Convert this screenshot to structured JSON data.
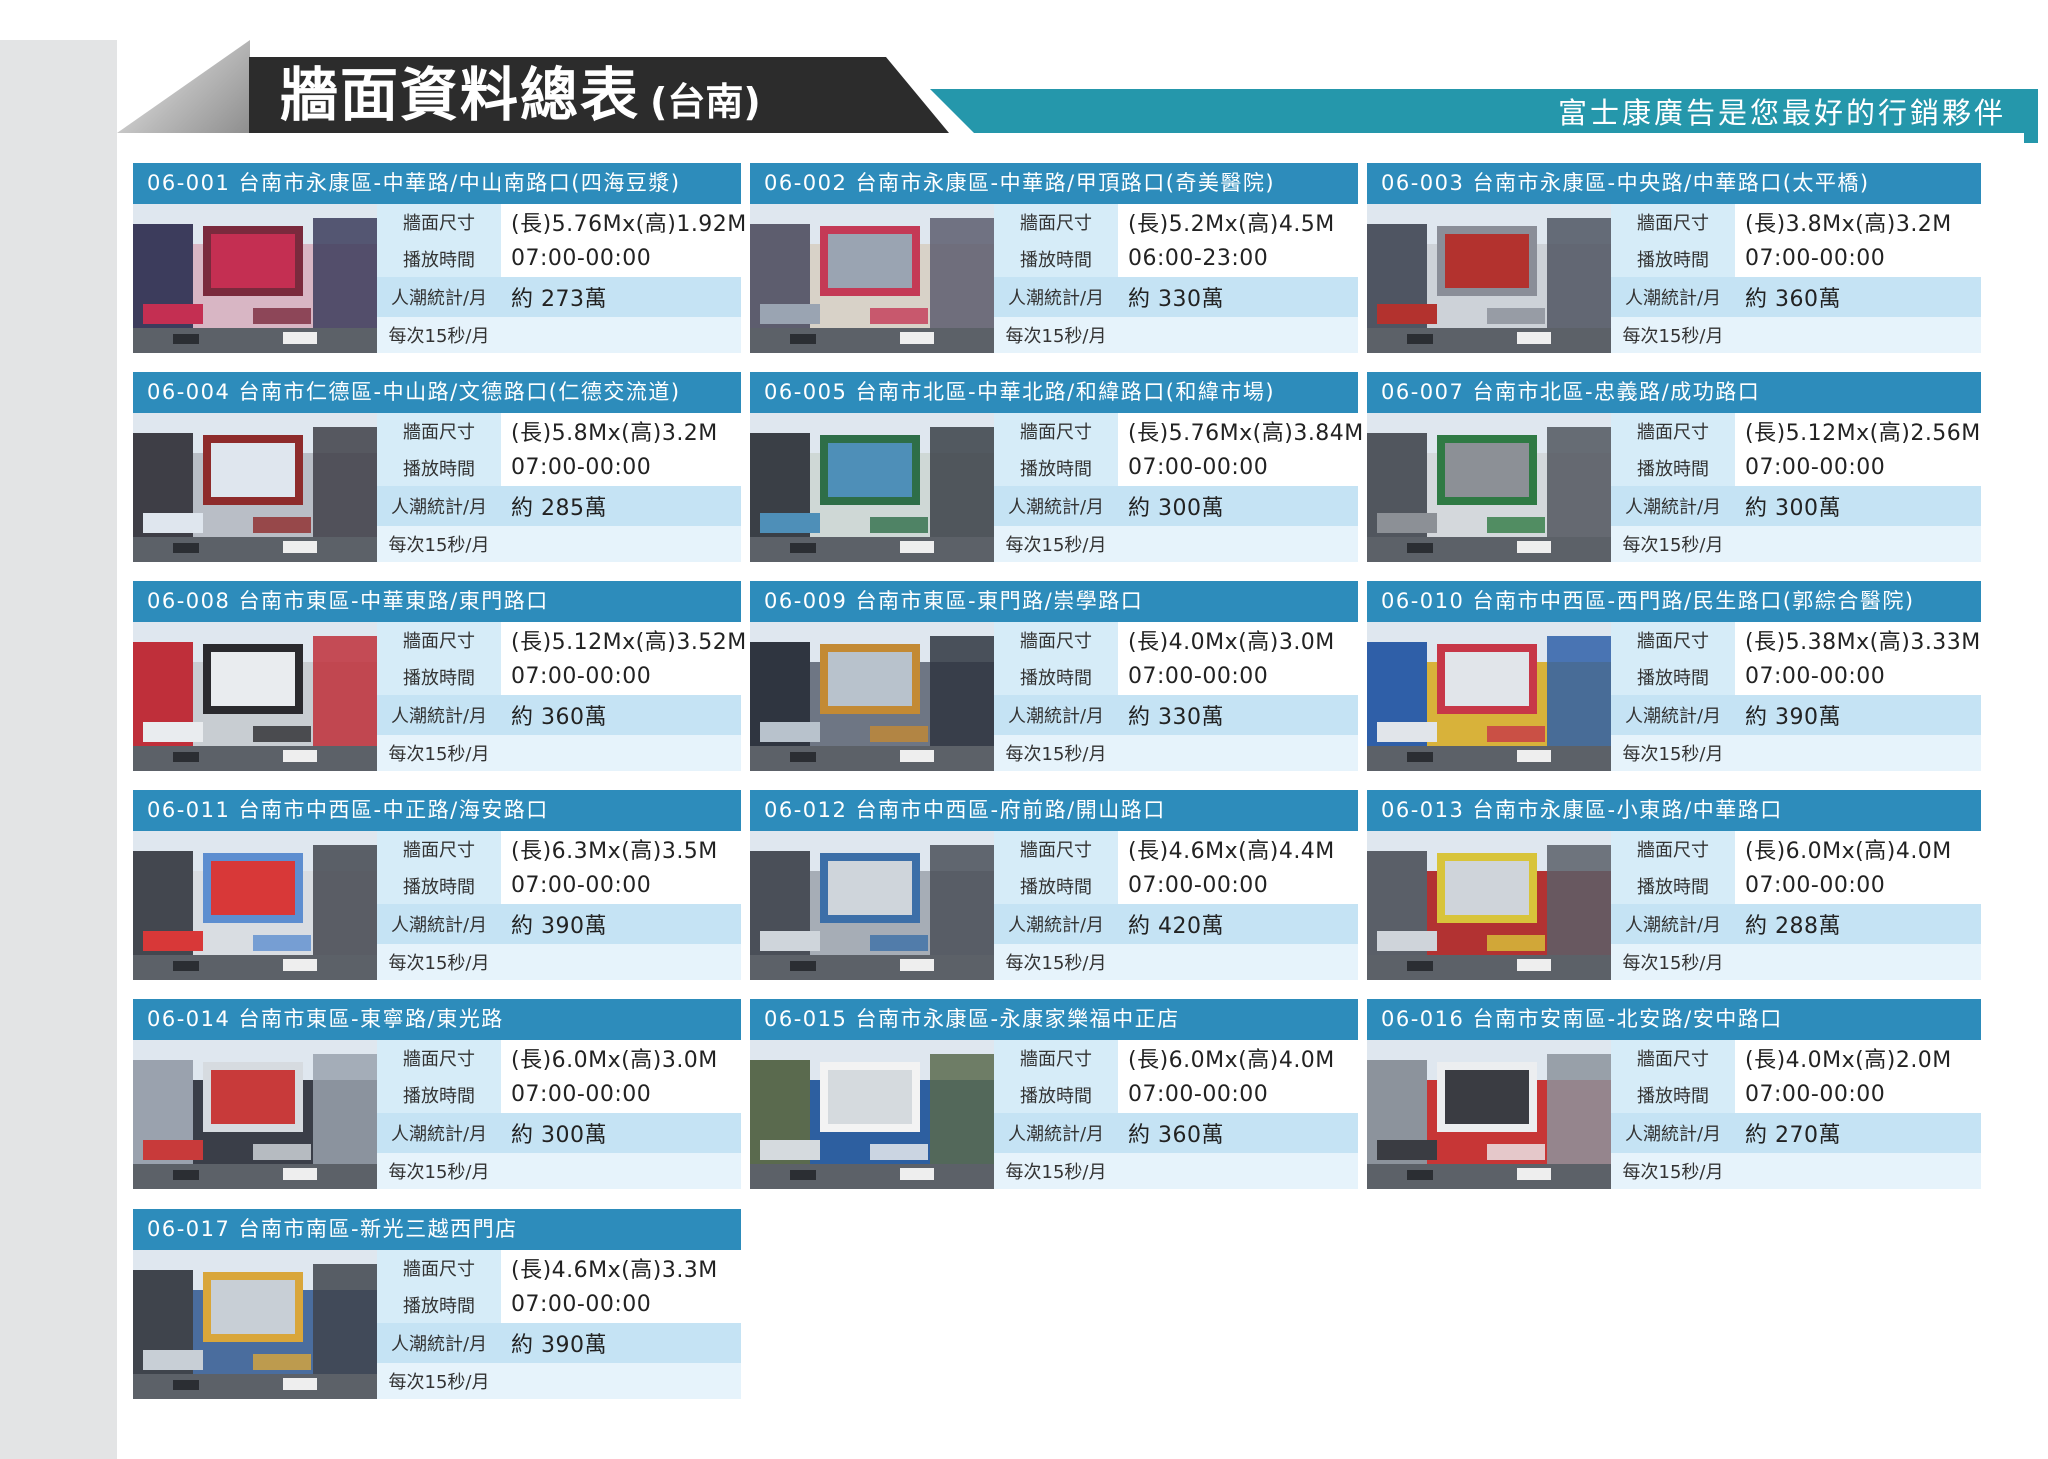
{
  "header": {
    "title": "牆面資料總表",
    "subtitle": "(台南)",
    "slogan": "富士康廣告是您最好的行銷夥伴"
  },
  "labels": {
    "size": "牆面尺寸",
    "time": "播放時間",
    "traffic": "人潮統計/月",
    "per": "每次15秒/月"
  },
  "cards": [
    {
      "title": "06-001 台南市永康區-中華路/中山南路口(四海豆漿)",
      "size": "(長)5.76Mx(高)1.92M",
      "time": "07:00-00:00",
      "traffic": "約 273萬",
      "photo": [
        "#c42f52",
        "#7a2a3d",
        "#d8b6c4",
        "#3c3c5c"
      ]
    },
    {
      "title": "06-002 台南市永康區-中華路/甲頂路口(奇美醫院)",
      "size": "(長)5.2Mx(高)4.5M",
      "time": "06:00-23:00",
      "traffic": "約 330萬",
      "photo": [
        "#9aa4b2",
        "#c43a56",
        "#d8d2c8",
        "#5d5d6e"
      ]
    },
    {
      "title": "06-003 台南市永康區-中央路/中華路口(太平橋)",
      "size": "(長)3.8Mx(高)3.2M",
      "time": "07:00-00:00",
      "traffic": "約 360萬",
      "photo": [
        "#b3322e",
        "#8a8e98",
        "#cdd2d8",
        "#4f5562"
      ]
    },
    {
      "title": "06-004 台南市仁德區-中山路/文德路口(仁德交流道)",
      "size": "(長)5.8Mx(高)3.2M",
      "time": "07:00-00:00",
      "traffic": "約 285萬",
      "photo": [
        "#dfe6ee",
        "#8e2b2b",
        "#b9bec6",
        "#3e3e46"
      ]
    },
    {
      "title": "06-005 台南市北區-中華北路/和緯路口(和緯市場)",
      "size": "(長)5.76Mx(高)3.84M",
      "time": "07:00-00:00",
      "traffic": "約 300萬",
      "photo": [
        "#4e8fb8",
        "#2e6e48",
        "#cfd8d6",
        "#3a3f46"
      ]
    },
    {
      "title": "06-007 台南市北區-忠義路/成功路口",
      "size": "(長)5.12Mx(高)2.56M",
      "time": "07:00-00:00",
      "traffic": "約 300萬",
      "photo": [
        "#8c9096",
        "#2f7a44",
        "#d4d8dc",
        "#51565e"
      ]
    },
    {
      "title": "06-008 台南市東區-中華東路/東門路口",
      "size": "(長)5.12Mx(高)3.52M",
      "time": "07:00-00:00",
      "traffic": "約 360萬",
      "photo": [
        "#e9ecef",
        "#2a2a2e",
        "#c8cdd2",
        "#bf2f3a"
      ]
    },
    {
      "title": "06-009 台南市東區-東門路/崇學路口",
      "size": "(長)4.0Mx(高)3.0M",
      "time": "07:00-00:00",
      "traffic": "約 330萬",
      "photo": [
        "#b8c2cc",
        "#c38a34",
        "#6e7684",
        "#2f3540"
      ]
    },
    {
      "title": "06-010 台南市中西區-西門路/民生路口(郭綜合醫院)",
      "size": "(長)5.38Mx(高)3.33M",
      "time": "07:00-00:00",
      "traffic": "約 390萬",
      "photo": [
        "#e1e5ea",
        "#c73748",
        "#d8b23a",
        "#2f5fa8"
      ]
    },
    {
      "title": "06-011 台南市中西區-中正路/海安路口",
      "size": "(長)6.3Mx(高)3.5M",
      "time": "07:00-00:00",
      "traffic": "約 390萬",
      "photo": [
        "#d83838",
        "#5d8ed0",
        "#d9dde2",
        "#43474f"
      ]
    },
    {
      "title": "06-012 台南市中西區-府前路/開山路口",
      "size": "(長)4.6Mx(高)4.4M",
      "time": "07:00-00:00",
      "traffic": "約 420萬",
      "photo": [
        "#cfd5db",
        "#3c6fa8",
        "#a6adb6",
        "#4a4f58"
      ]
    },
    {
      "title": "06-013 台南市永康區-小東路/中華路口",
      "size": "(長)6.0Mx(高)4.0M",
      "time": "07:00-00:00",
      "traffic": "約 288萬",
      "photo": [
        "#cfd4da",
        "#d8c43a",
        "#b23232",
        "#5a5f68"
      ]
    },
    {
      "title": "06-014 台南市東區-東寧路/東光路",
      "size": "(長)6.0Mx(高)3.0M",
      "time": "07:00-00:00",
      "traffic": "約 300萬",
      "photo": [
        "#c83a3a",
        "#d6dbe0",
        "#3a3e48",
        "#9aa2ae"
      ]
    },
    {
      "title": "06-015 台南市永康區-永康家樂福中正店",
      "size": "(長)6.0Mx(高)4.0M",
      "time": "07:00-00:00",
      "traffic": "約 360萬",
      "photo": [
        "#d5dade",
        "#f3f3f3",
        "#2d5fa0",
        "#5a6a4e"
      ]
    },
    {
      "title": "06-016 台南市安南區-北安路/安中路口",
      "size": "(長)4.0Mx(高)2.0M",
      "time": "07:00-00:00",
      "traffic": "約 270萬",
      "photo": [
        "#3a3c42",
        "#eceef0",
        "#c73636",
        "#8c939c"
      ]
    },
    {
      "title": "06-017 台南市南區-新光三越西門店",
      "size": "(長)4.6Mx(高)3.3M",
      "time": "07:00-00:00",
      "traffic": "約 390萬",
      "photo": [
        "#c8cfd6",
        "#d9a63a",
        "#4a6d9e",
        "#3f444c"
      ]
    }
  ]
}
